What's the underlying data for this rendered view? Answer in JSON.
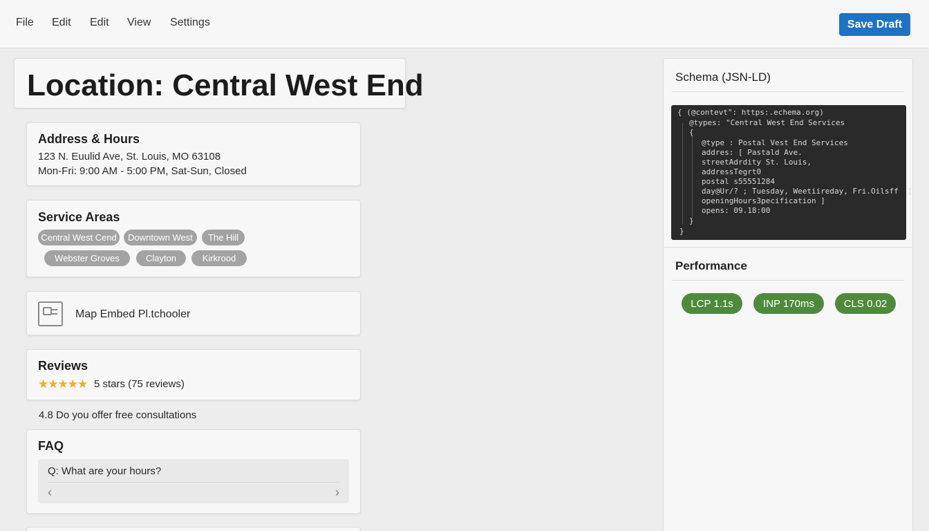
{
  "menu": {
    "items": [
      "File",
      "Edit",
      "Edit",
      "View",
      "Settings"
    ],
    "save_label": "Save Draft"
  },
  "page": {
    "title": "Location: Central West End"
  },
  "address": {
    "title": "Address & Hours",
    "street": "123 N. Euulid Ave, St. Louis, MO 63108",
    "hours": "Mon-Fri: 9:00 AM - 5:00 PM, Sat-Sun, Closed"
  },
  "service_areas": {
    "title": "Service Areas",
    "chips": [
      "Central West Cend",
      "Downtown West",
      "The Hill",
      "Webster Groves",
      "Clayton",
      "Kirkrood"
    ]
  },
  "map": {
    "label": "Map Embed Pl.tchooler"
  },
  "reviews": {
    "title": "Reviews",
    "stars": "★★★★★",
    "text": "5 stars (75 reviews)",
    "rating_value": 4.8
  },
  "stray_line": "4.8 Do you offer free consultations",
  "faq": {
    "title": "FAQ",
    "question": "Q: What are your hours?",
    "prev": "‹",
    "next": "›"
  },
  "schema": {
    "title": "Schema (JSN-LD)",
    "lines": [
      "{ (@contevt\": https:.echema.org)",
      "@types: \"Central West End Services",
      "{",
      "@type : Postal Vest End Services",
      "addres: [ Pastald Ave.",
      "streetAdrdity St. Louis,",
      "addressTegrt0",
      "postal s55551284",
      "day@Ur/? ; Tuesday, Weetiireday, Fri.Oilsff  [",
      "openingHours3pecification ]",
      "opens: 09.18:00",
      "}",
      "}"
    ]
  },
  "performance": {
    "title": "Performance",
    "metrics": [
      "LCP 1.1s",
      "INP 170ms",
      "CLS 0.02"
    ]
  },
  "colors": {
    "accent": "#1f72c3",
    "metric": "#4f8a3c",
    "chip": "#a3a3a3",
    "star": "#f0ae1e"
  }
}
